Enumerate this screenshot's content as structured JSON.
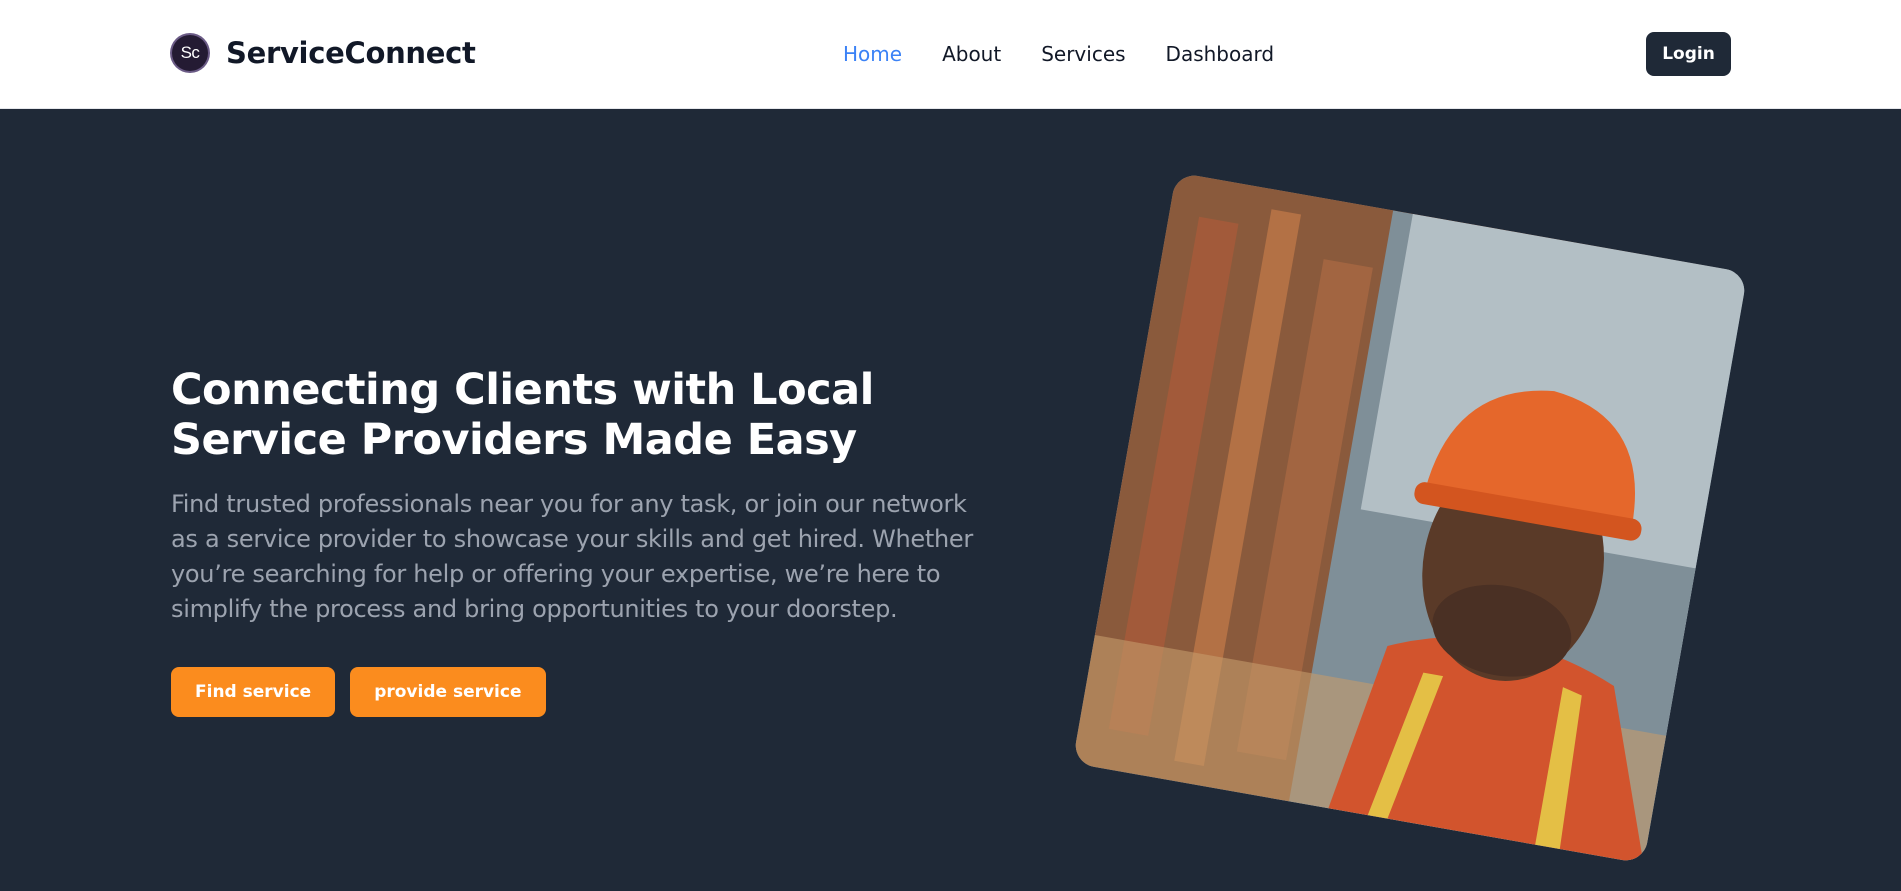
{
  "header": {
    "logo_text": "Sc",
    "brand_name": "ServiceConnect",
    "nav": [
      {
        "label": "Home",
        "active": true
      },
      {
        "label": "About",
        "active": false
      },
      {
        "label": "Services",
        "active": false
      },
      {
        "label": "Dashboard",
        "active": false
      }
    ],
    "login_label": "Login"
  },
  "hero": {
    "title": "Connecting Clients with Local Service Providers Made Easy",
    "description": "Find trusted professionals near you for any task, or join our network as a service provider to showcase your skills and get hired. Whether you’re searching for help or offering your expertise, we’re here to simplify the process and bring opportunities to your doorstep.",
    "buttons": {
      "find": "Find service",
      "provide": "provide service"
    },
    "image_subject": "construction-worker-photo"
  },
  "colors": {
    "background": "#1f2937",
    "header_bg": "#ffffff",
    "accent": "#fb8c1e",
    "active_link": "#3b82f6",
    "text_muted": "#9ca3af"
  }
}
